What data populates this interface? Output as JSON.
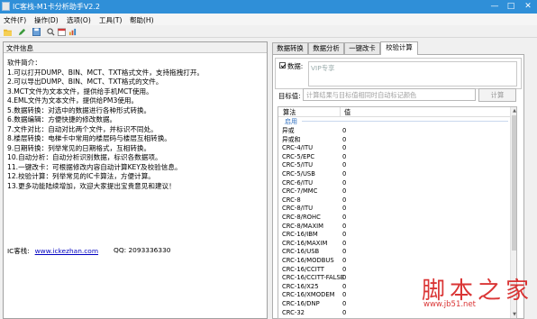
{
  "window": {
    "title": "IC客栈-M1卡分析助手V2.2"
  },
  "menu": [
    "文件(F)",
    "操作(D)",
    "选项(O)",
    "工具(T)",
    "帮助(H)"
  ],
  "left": {
    "header": "文件信息",
    "intro": [
      "软件简介：",
      "1.可以打开DUMP、BIN、MCT、TXT格式文件，支持拖拽打开。",
      "2.可以导出DUMP、BIN、MCT、TXT格式的文件。",
      "3.MCT文件为文本文件，提供给手机MCT使用。",
      "4.EML文件为文本文件，提供给PM3使用。",
      "5.数据转换：对选中的数据进行各种形式转换。",
      "6.数据编辑：方便快捷的修改数据。",
      "7.文件对比：自动对比两个文件，并标识不同处。",
      "8.楼层转换：电梯卡中常用的楼层码与楼层互相转换。",
      "9.日期转换：列举常见的日期格式，互相转换。",
      "10.自动分析：自动分析识别数据，标识各数据项。",
      "11.一键改卡：可根据修改内容自动计算KEY及校验信息。",
      "12.校验计算：列举常见的IC卡算法，方便计算。",
      "13.更多功能陆续增加，欢迎大家提出宝贵意见和建议！"
    ],
    "contact_label": "IC客栈:",
    "contact_url": "www.ickezhan.com",
    "qq": "QQ: 2093336330"
  },
  "tabs": [
    "数据转换",
    "数据分析",
    "一键改卡",
    "校验计算"
  ],
  "active_tab": 3,
  "calc": {
    "data_label": "数据:",
    "data_placeholder": "VIP专享",
    "target_label": "目标值:",
    "target_placeholder": "计算结果与目标值相同时自动标记颜色",
    "button_label": "计算",
    "col_algo": "算法",
    "col_value": "值",
    "group_label": "启用",
    "rows": [
      [
        "异或",
        "0"
      ],
      [
        "异或和",
        "0"
      ],
      [
        "CRC-4/ITU",
        "0"
      ],
      [
        "CRC-5/EPC",
        "0"
      ],
      [
        "CRC-5/ITU",
        "0"
      ],
      [
        "CRC-5/USB",
        "0"
      ],
      [
        "CRC-6/ITU",
        "0"
      ],
      [
        "CRC-7/MMC",
        "0"
      ],
      [
        "CRC-8",
        "0"
      ],
      [
        "CRC-8/ITU",
        "0"
      ],
      [
        "CRC-8/ROHC",
        "0"
      ],
      [
        "CRC-8/MAXIM",
        "0"
      ],
      [
        "CRC-16/IBM",
        "0"
      ],
      [
        "CRC-16/MAXIM",
        "0"
      ],
      [
        "CRC-16/USB",
        "0"
      ],
      [
        "CRC-16/MODBUS",
        "0"
      ],
      [
        "CRC-16/CCITT",
        "0"
      ],
      [
        "CRC-16/CCITT-FALSE",
        "0"
      ],
      [
        "CRC-16/X25",
        "0"
      ],
      [
        "CRC-16/XMODEM",
        "0"
      ],
      [
        "CRC-16/DNP",
        "0"
      ],
      [
        "CRC-32",
        "0"
      ]
    ]
  },
  "watermark": {
    "logo": "脚本之家",
    "url": "www.jb51.net"
  },
  "colors": {
    "titlebar": "#2f8fd8",
    "link": "#0000c0",
    "watermark": "#d62020"
  },
  "icons": [
    "open-folder-icon",
    "pencil-icon",
    "save-icon",
    "search-icon",
    "calendar-icon",
    "analyze-icon"
  ]
}
